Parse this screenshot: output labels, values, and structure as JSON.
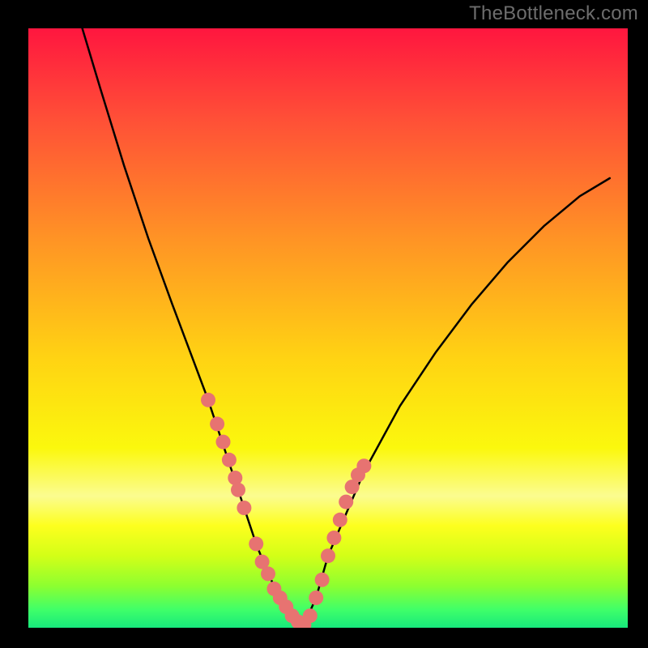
{
  "watermark": "TheBottleneck.com",
  "chart_data": {
    "type": "line",
    "title": "",
    "xlabel": "",
    "ylabel": "",
    "xlim": [
      0,
      100
    ],
    "ylim": [
      0,
      100
    ],
    "gradient_stops": [
      {
        "offset": 0.0,
        "color": "#ff163f"
      },
      {
        "offset": 0.15,
        "color": "#ff4f37"
      },
      {
        "offset": 0.35,
        "color": "#ff9325"
      },
      {
        "offset": 0.55,
        "color": "#ffd313"
      },
      {
        "offset": 0.7,
        "color": "#fbf80d"
      },
      {
        "offset": 0.78,
        "color": "#fbfc90"
      },
      {
        "offset": 0.83,
        "color": "#fdff1e"
      },
      {
        "offset": 0.88,
        "color": "#d3ff17"
      },
      {
        "offset": 0.93,
        "color": "#8dff30"
      },
      {
        "offset": 0.97,
        "color": "#3fff69"
      },
      {
        "offset": 1.0,
        "color": "#17e87c"
      }
    ],
    "series": [
      {
        "name": "bottleneck-curve",
        "type": "line",
        "x_pct": [
          9.0,
          12.0,
          16.0,
          20.0,
          24.0,
          27.0,
          30.0,
          32.0,
          34.0,
          36.0,
          38.0,
          40.0,
          42.0,
          44.0,
          46.0,
          48.0,
          50.0,
          56.0,
          62.0,
          68.0,
          74.0,
          80.0,
          86.0,
          92.0,
          97.0
        ],
        "y_pct": [
          100.0,
          90.0,
          77.0,
          65.0,
          54.0,
          46.0,
          38.0,
          32.0,
          26.0,
          20.0,
          14.0,
          9.0,
          5.0,
          2.0,
          0.5,
          5.0,
          12.0,
          26.0,
          37.0,
          46.0,
          54.0,
          61.0,
          67.0,
          72.0,
          75.0
        ]
      },
      {
        "name": "pink-markers",
        "type": "scatter",
        "x_pct": [
          30.0,
          31.5,
          32.5,
          33.5,
          34.5,
          35.0,
          36.0,
          38.0,
          39.0,
          40.0,
          41.0,
          42.0,
          43.0,
          44.0,
          45.0,
          46.0,
          47.0,
          48.0,
          49.0,
          50.0,
          51.0,
          52.0,
          53.0,
          54.0,
          55.0,
          56.0
        ],
        "y_pct": [
          38.0,
          34.0,
          31.0,
          28.0,
          25.0,
          23.0,
          20.0,
          14.0,
          11.0,
          9.0,
          6.5,
          5.0,
          3.5,
          2.0,
          1.0,
          0.5,
          2.0,
          5.0,
          8.0,
          12.0,
          15.0,
          18.0,
          21.0,
          23.5,
          25.5,
          27.0
        ]
      }
    ],
    "marker_color": "#e77371",
    "curve_color": "#000000"
  }
}
